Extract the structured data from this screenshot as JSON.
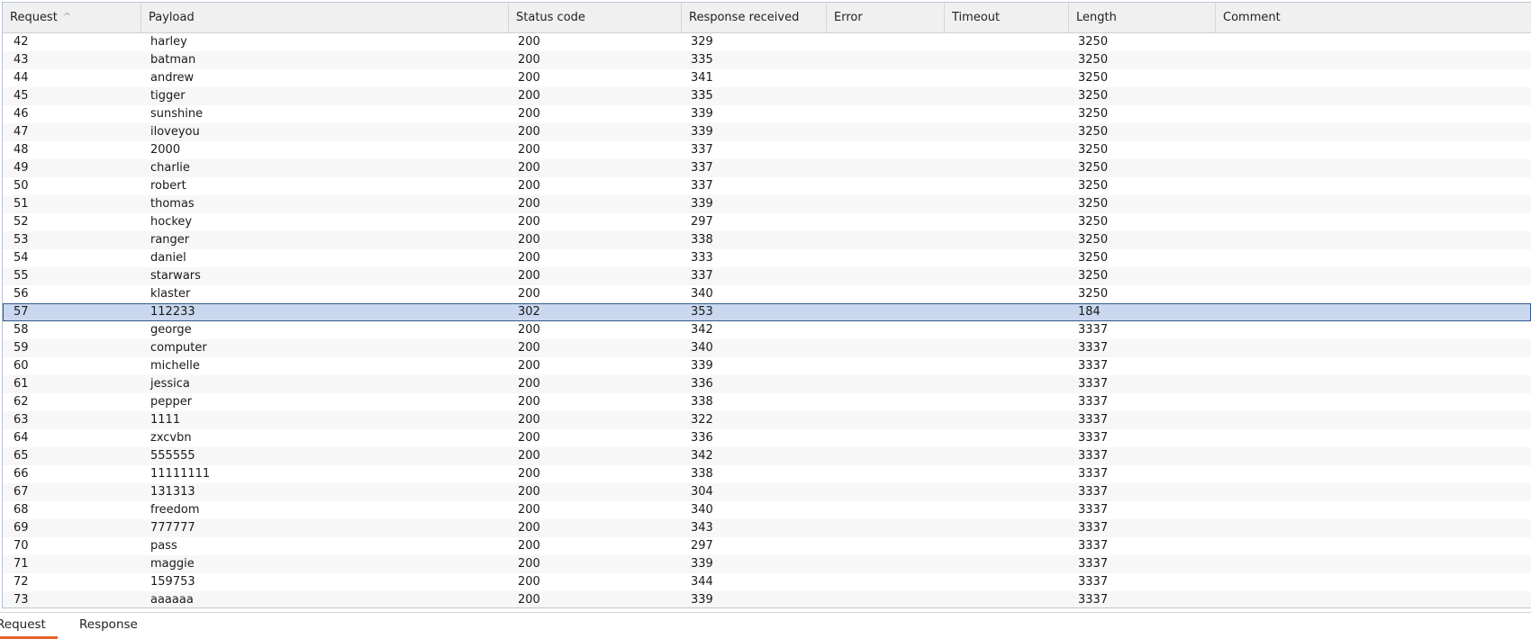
{
  "table": {
    "columns": [
      {
        "key": "request",
        "label": "Request"
      },
      {
        "key": "payload",
        "label": "Payload"
      },
      {
        "key": "status",
        "label": "Status code"
      },
      {
        "key": "response",
        "label": "Response received"
      },
      {
        "key": "error",
        "label": "Error"
      },
      {
        "key": "timeout",
        "label": "Timeout"
      },
      {
        "key": "length",
        "label": "Length"
      },
      {
        "key": "comment",
        "label": "Comment"
      }
    ],
    "sort_column": "request",
    "sort_icon": "sort-ascending-icon",
    "sort_glyph": "^",
    "selected_request": "57",
    "rows": [
      {
        "request": "42",
        "payload": "harley",
        "status": "200",
        "response": "329",
        "error": "",
        "timeout": "",
        "length": "3250",
        "comment": ""
      },
      {
        "request": "43",
        "payload": "batman",
        "status": "200",
        "response": "335",
        "error": "",
        "timeout": "",
        "length": "3250",
        "comment": ""
      },
      {
        "request": "44",
        "payload": "andrew",
        "status": "200",
        "response": "341",
        "error": "",
        "timeout": "",
        "length": "3250",
        "comment": ""
      },
      {
        "request": "45",
        "payload": "tigger",
        "status": "200",
        "response": "335",
        "error": "",
        "timeout": "",
        "length": "3250",
        "comment": ""
      },
      {
        "request": "46",
        "payload": "sunshine",
        "status": "200",
        "response": "339",
        "error": "",
        "timeout": "",
        "length": "3250",
        "comment": ""
      },
      {
        "request": "47",
        "payload": "iloveyou",
        "status": "200",
        "response": "339",
        "error": "",
        "timeout": "",
        "length": "3250",
        "comment": ""
      },
      {
        "request": "48",
        "payload": "2000",
        "status": "200",
        "response": "337",
        "error": "",
        "timeout": "",
        "length": "3250",
        "comment": ""
      },
      {
        "request": "49",
        "payload": "charlie",
        "status": "200",
        "response": "337",
        "error": "",
        "timeout": "",
        "length": "3250",
        "comment": ""
      },
      {
        "request": "50",
        "payload": "robert",
        "status": "200",
        "response": "337",
        "error": "",
        "timeout": "",
        "length": "3250",
        "comment": ""
      },
      {
        "request": "51",
        "payload": "thomas",
        "status": "200",
        "response": "339",
        "error": "",
        "timeout": "",
        "length": "3250",
        "comment": ""
      },
      {
        "request": "52",
        "payload": "hockey",
        "status": "200",
        "response": "297",
        "error": "",
        "timeout": "",
        "length": "3250",
        "comment": ""
      },
      {
        "request": "53",
        "payload": "ranger",
        "status": "200",
        "response": "338",
        "error": "",
        "timeout": "",
        "length": "3250",
        "comment": ""
      },
      {
        "request": "54",
        "payload": "daniel",
        "status": "200",
        "response": "333",
        "error": "",
        "timeout": "",
        "length": "3250",
        "comment": ""
      },
      {
        "request": "55",
        "payload": "starwars",
        "status": "200",
        "response": "337",
        "error": "",
        "timeout": "",
        "length": "3250",
        "comment": ""
      },
      {
        "request": "56",
        "payload": "klaster",
        "status": "200",
        "response": "340",
        "error": "",
        "timeout": "",
        "length": "3250",
        "comment": ""
      },
      {
        "request": "57",
        "payload": "112233",
        "status": "302",
        "response": "353",
        "error": "",
        "timeout": "",
        "length": "184",
        "comment": ""
      },
      {
        "request": "58",
        "payload": "george",
        "status": "200",
        "response": "342",
        "error": "",
        "timeout": "",
        "length": "3337",
        "comment": ""
      },
      {
        "request": "59",
        "payload": "computer",
        "status": "200",
        "response": "340",
        "error": "",
        "timeout": "",
        "length": "3337",
        "comment": ""
      },
      {
        "request": "60",
        "payload": "michelle",
        "status": "200",
        "response": "339",
        "error": "",
        "timeout": "",
        "length": "3337",
        "comment": ""
      },
      {
        "request": "61",
        "payload": "jessica",
        "status": "200",
        "response": "336",
        "error": "",
        "timeout": "",
        "length": "3337",
        "comment": ""
      },
      {
        "request": "62",
        "payload": "pepper",
        "status": "200",
        "response": "338",
        "error": "",
        "timeout": "",
        "length": "3337",
        "comment": ""
      },
      {
        "request": "63",
        "payload": "1111",
        "status": "200",
        "response": "322",
        "error": "",
        "timeout": "",
        "length": "3337",
        "comment": ""
      },
      {
        "request": "64",
        "payload": "zxcvbn",
        "status": "200",
        "response": "336",
        "error": "",
        "timeout": "",
        "length": "3337",
        "comment": ""
      },
      {
        "request": "65",
        "payload": "555555",
        "status": "200",
        "response": "342",
        "error": "",
        "timeout": "",
        "length": "3337",
        "comment": ""
      },
      {
        "request": "66",
        "payload": "11111111",
        "status": "200",
        "response": "338",
        "error": "",
        "timeout": "",
        "length": "3337",
        "comment": ""
      },
      {
        "request": "67",
        "payload": "131313",
        "status": "200",
        "response": "304",
        "error": "",
        "timeout": "",
        "length": "3337",
        "comment": ""
      },
      {
        "request": "68",
        "payload": "freedom",
        "status": "200",
        "response": "340",
        "error": "",
        "timeout": "",
        "length": "3337",
        "comment": ""
      },
      {
        "request": "69",
        "payload": "777777",
        "status": "200",
        "response": "343",
        "error": "",
        "timeout": "",
        "length": "3337",
        "comment": ""
      },
      {
        "request": "70",
        "payload": "pass",
        "status": "200",
        "response": "297",
        "error": "",
        "timeout": "",
        "length": "3337",
        "comment": ""
      },
      {
        "request": "71",
        "payload": "maggie",
        "status": "200",
        "response": "339",
        "error": "",
        "timeout": "",
        "length": "3337",
        "comment": ""
      },
      {
        "request": "72",
        "payload": "159753",
        "status": "200",
        "response": "344",
        "error": "",
        "timeout": "",
        "length": "3337",
        "comment": ""
      },
      {
        "request": "73",
        "payload": "aaaaaa",
        "status": "200",
        "response": "339",
        "error": "",
        "timeout": "",
        "length": "3337",
        "comment": ""
      }
    ]
  },
  "bottom_tabs": {
    "active": "Request",
    "items": [
      {
        "label": "Request"
      },
      {
        "label": "Response"
      }
    ]
  },
  "colors": {
    "selection_fill": "#c9d8ee",
    "selection_border": "#30598c",
    "active_tab_underline": "#e8622c"
  }
}
